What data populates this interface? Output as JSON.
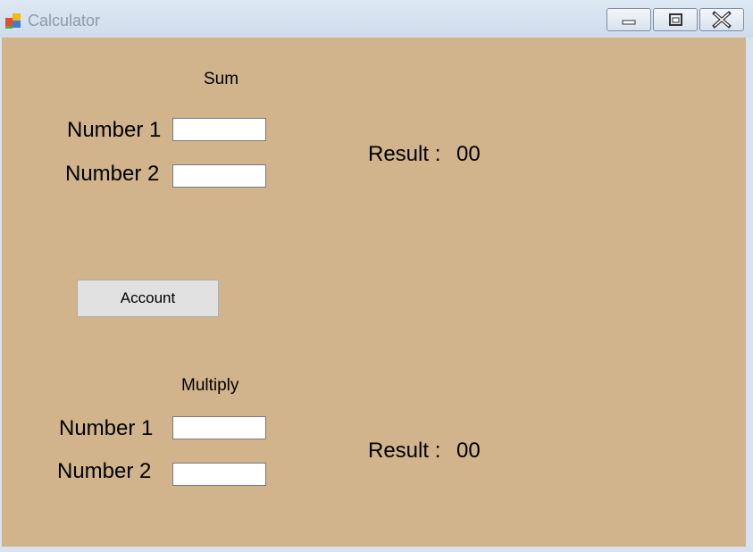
{
  "window": {
    "title": "Calculator",
    "app_icon": "windows-forms-icon",
    "controls": [
      "minimize-icon",
      "maximize-icon",
      "close-icon"
    ]
  },
  "colors": {
    "form_background": "#d1b48c",
    "titlebar": "#dde8f4"
  },
  "sum": {
    "heading": "Sum",
    "number1_label": "Number 1",
    "number2_label": "Number 2",
    "number1_value": "",
    "number2_value": "",
    "result_label": "Result :",
    "result_value": "00"
  },
  "account_button": "Account",
  "multiply": {
    "heading": "Multiply",
    "number1_label": "Number 1",
    "number2_label": "Number 2",
    "number1_value": "",
    "number2_value": "",
    "result_label": "Result :",
    "result_value": "00"
  }
}
